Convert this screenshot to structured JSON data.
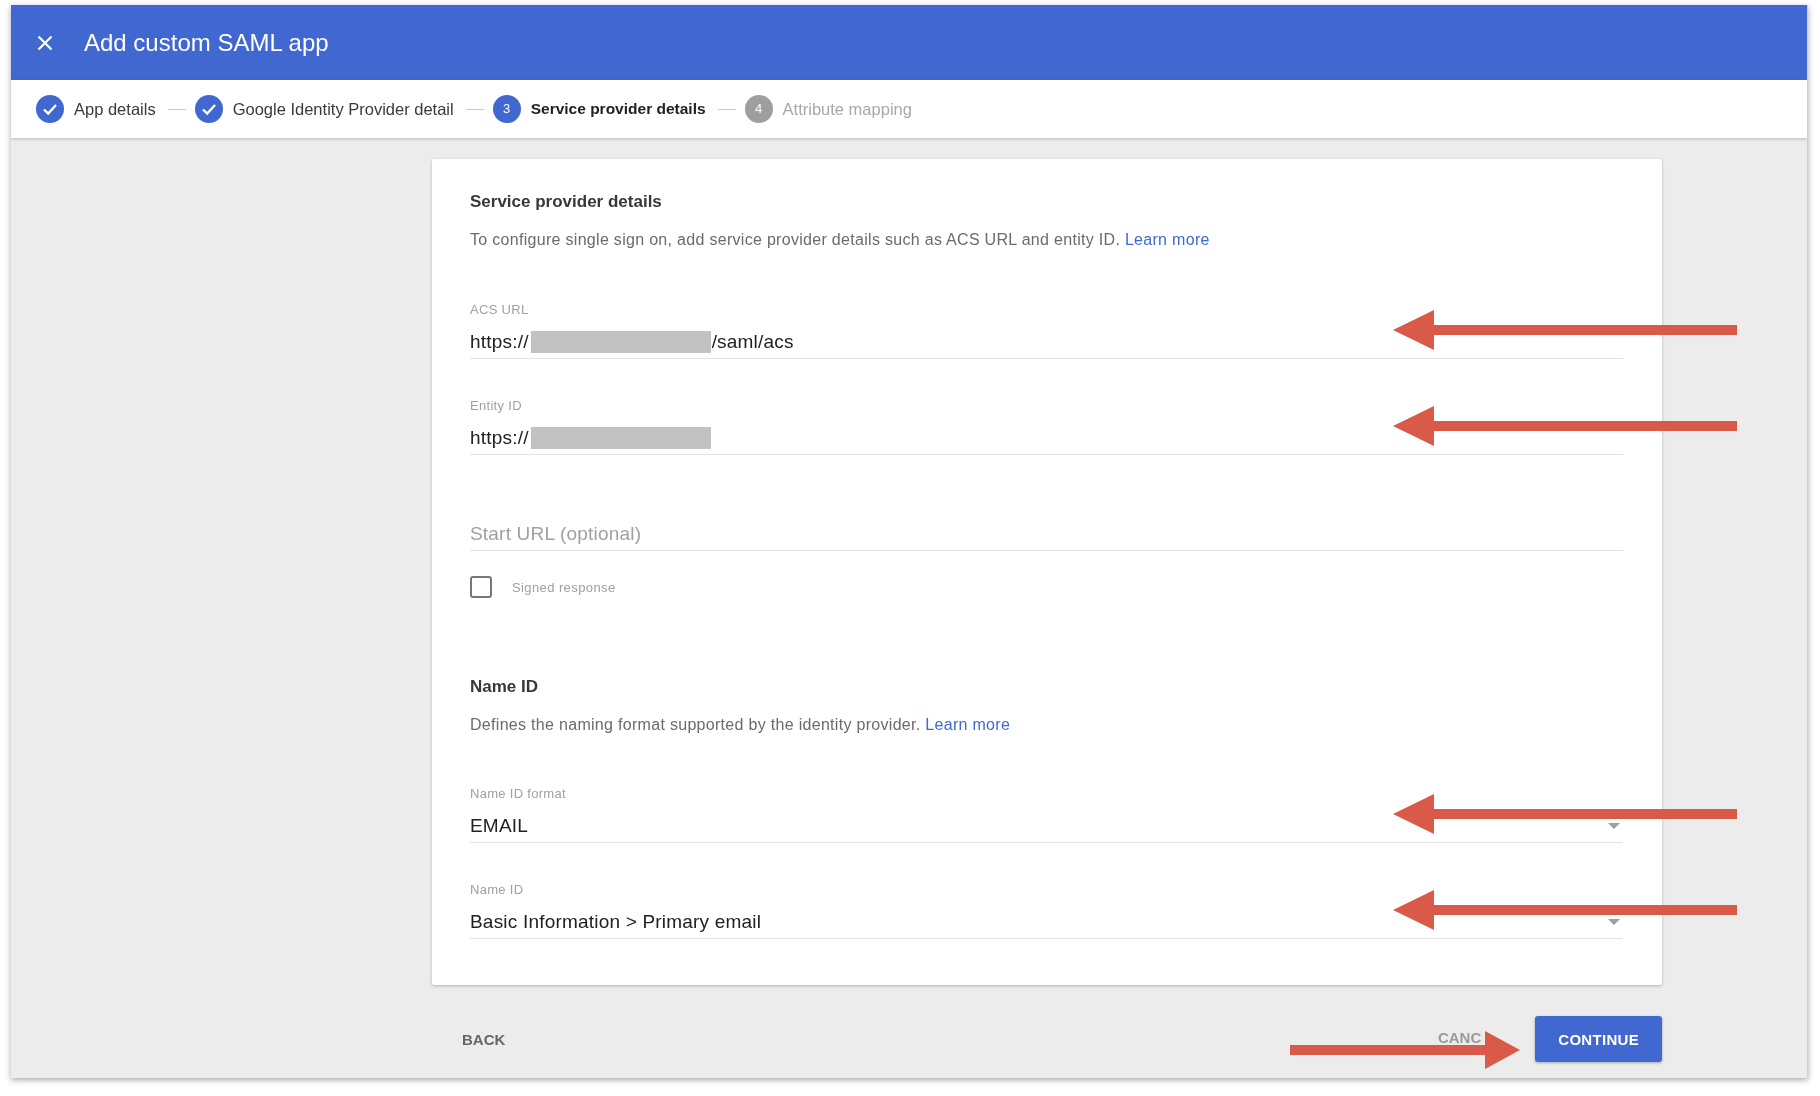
{
  "window": {
    "title": "Add custom SAML app"
  },
  "steps": [
    {
      "label": "App details",
      "completed": true,
      "selected": false
    },
    {
      "label": "Google Identity Provider detail",
      "completed": true,
      "selected": false
    },
    {
      "number": "3",
      "label": "Service provider details",
      "completed": false,
      "selected": true
    },
    {
      "number": "4",
      "label": "Attribute mapping",
      "completed": false,
      "selected": false
    }
  ],
  "sections": [
    {
      "heading": "Service provider details",
      "description": "To configure single sign on, add service provider details such as ACS URL and entity ID.",
      "link": "Learn more",
      "fields": [
        {
          "kind": "text",
          "label": "ACS URL",
          "value": "https://",
          "redacted": true,
          "value_end": "/saml/acs",
          "highlighted": true
        },
        {
          "kind": "text",
          "label": "Entity ID",
          "value": "https://",
          "redacted": true,
          "highlighted": true
        },
        {
          "kind": "text",
          "placeholder": "Start URL (optional)",
          "highlighted": false
        },
        {
          "kind": "checkbox",
          "label": "Signed response",
          "checked": false
        }
      ]
    },
    {
      "heading": "Name ID",
      "description": "Defines the naming format supported by the identity provider.",
      "link": "Learn more",
      "fields": [
        {
          "kind": "select",
          "label": "Name ID format",
          "value": "EMAIL",
          "highlighted": true
        },
        {
          "kind": "select",
          "label": "Name ID",
          "value": "Basic Information > Primary email",
          "highlighted": true
        }
      ]
    }
  ],
  "footer": {
    "back": {
      "label": "BACK"
    },
    "cancel": {
      "label": "CANC"
    },
    "continue": {
      "label": "CONTINUE",
      "highlighted": true
    }
  }
}
